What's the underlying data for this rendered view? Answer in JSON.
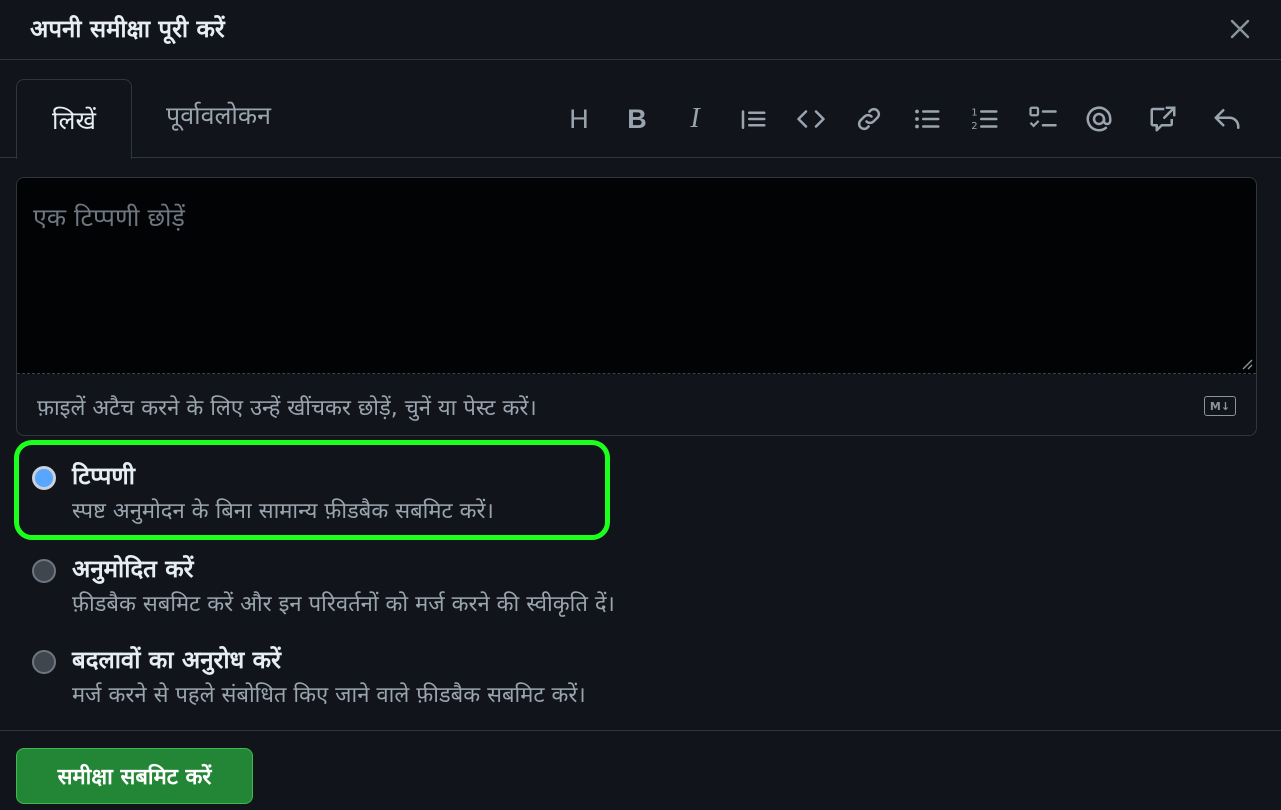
{
  "dialog": {
    "title": "अपनी समीक्षा पूरी करें",
    "close_icon": "x-icon"
  },
  "tabs": [
    {
      "label": "लिखें",
      "selected": true
    },
    {
      "label": "पूर्वावलोकन",
      "selected": false
    }
  ],
  "toolbar": {
    "heading": "H",
    "bold": "B",
    "italic": "I",
    "icons": [
      "heading-icon",
      "bold-icon",
      "italic-icon",
      "quote-icon",
      "code-icon",
      "link-icon",
      "unordered-list-icon",
      "ordered-list-icon",
      "task-list-icon",
      "mention-icon",
      "cross-reference-icon",
      "undo-icon"
    ]
  },
  "editor": {
    "placeholder": "एक टिप्पणी छोड़ें",
    "attach_hint": "फ़ाइलें अटैच करने के लिए उन्हें खींचकर छोड़ें, चुनें या पेस्ट करें।",
    "markdown_badge": "M↓"
  },
  "review_options": [
    {
      "label": "टिप्पणी",
      "description": "स्पष्ट अनुमोदन के बिना सामान्य फ़ीडबैक सबमिट करें।",
      "checked": true
    },
    {
      "label": "अनुमोदित करें",
      "description": "फ़ीडबैक सबमिट करें और इन परिवर्तनों को मर्ज करने की स्वीकृति दें।",
      "checked": false
    },
    {
      "label": "बदलावों का अनुरोध करें",
      "description": "मर्ज करने से पहले संबोधित किए जाने वाले फ़ीडबैक सबमिट करें।",
      "checked": false
    }
  ],
  "submit_button": "समीक्षा सबमिट करें",
  "colors": {
    "background": "#11151b",
    "highlight": "#1dff1d",
    "submit": "#238636",
    "radio_selected": "#58a6ff"
  }
}
